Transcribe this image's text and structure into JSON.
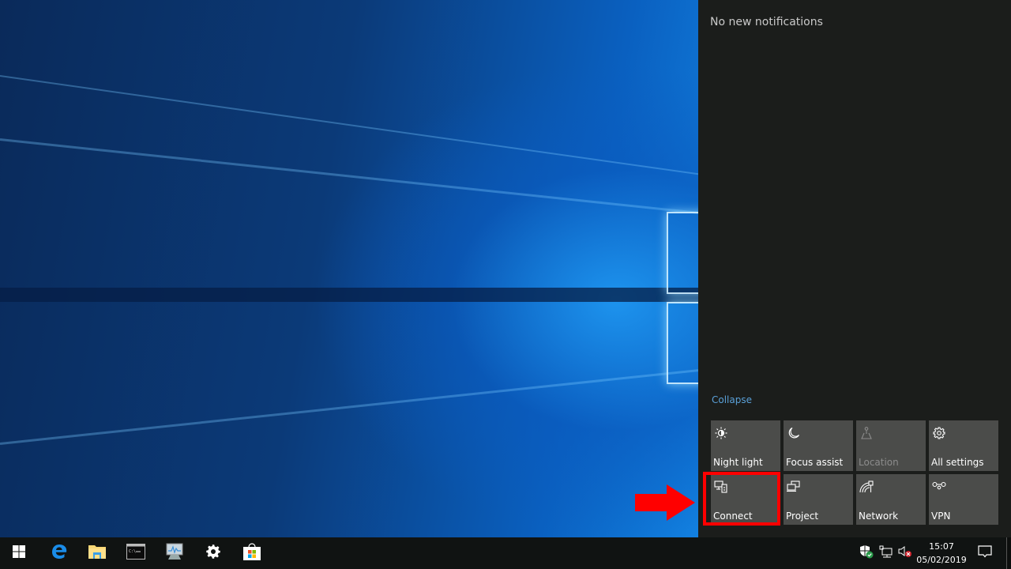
{
  "desktop": {
    "wallpaper": "Windows 10 hero wallpaper",
    "accent_color": "#0a78d7"
  },
  "action_center": {
    "notifications_text": "No new notifications",
    "collapse_label": "Collapse",
    "quick_actions": [
      {
        "label": "Night light",
        "icon": "night-light-icon",
        "enabled": true
      },
      {
        "label": "Focus assist",
        "icon": "moon-icon",
        "enabled": true
      },
      {
        "label": "Location",
        "icon": "location-icon",
        "enabled": false
      },
      {
        "label": "All settings",
        "icon": "gear-icon",
        "enabled": true
      },
      {
        "label": "Connect",
        "icon": "connect-icon",
        "enabled": true
      },
      {
        "label": "Project",
        "icon": "project-icon",
        "enabled": true
      },
      {
        "label": "Network",
        "icon": "network-icon",
        "enabled": true
      },
      {
        "label": "VPN",
        "icon": "vpn-icon",
        "enabled": true
      }
    ],
    "highlighted_action": "Connect",
    "highlight_color": "#ff0000"
  },
  "taskbar": {
    "pinned": [
      {
        "name": "Start",
        "icon": "windows-logo-icon"
      },
      {
        "name": "Microsoft Edge",
        "icon": "edge-icon"
      },
      {
        "name": "File Explorer",
        "icon": "folder-icon"
      },
      {
        "name": "Command Prompt",
        "icon": "cmd-icon"
      },
      {
        "name": "Resource Monitor",
        "icon": "monitor-icon"
      },
      {
        "name": "Settings",
        "icon": "gear-icon"
      },
      {
        "name": "Microsoft Store",
        "icon": "store-icon"
      }
    ],
    "tray": {
      "icons": [
        "security-shield-icon",
        "network-wired-icon",
        "volume-muted-icon"
      ],
      "time": "15:07",
      "date": "05/02/2019",
      "action_center_icon": "notification-icon"
    }
  }
}
